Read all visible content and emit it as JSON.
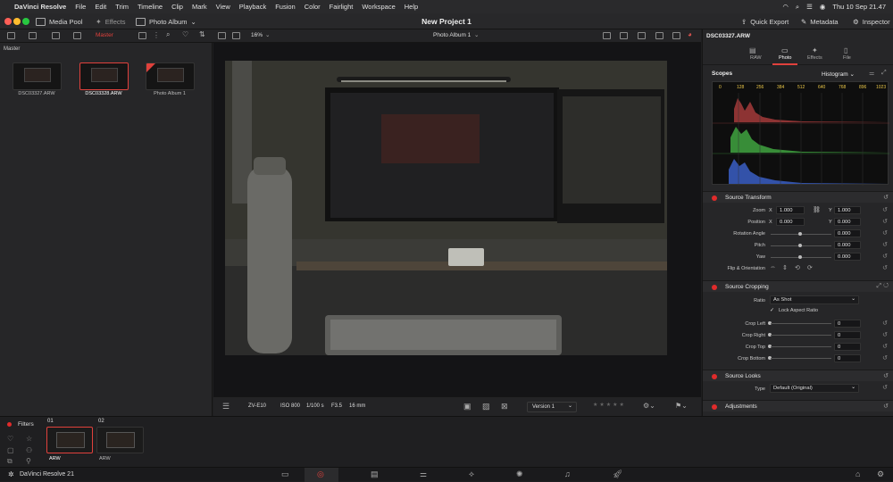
{
  "menubar": {
    "app": "DaVinci Resolve",
    "items": [
      "File",
      "Edit",
      "Trim",
      "Timeline",
      "Clip",
      "Mark",
      "View",
      "Playback",
      "Fusion",
      "Color",
      "Fairlight",
      "Workspace",
      "Help"
    ],
    "clock": "Thu 10 Sep  21.47"
  },
  "titlebar": {
    "media_pool": "Media Pool",
    "effects": "Effects",
    "album": "Photo Album",
    "project": "New Project 1",
    "quick_export": "Quick Export",
    "metadata": "Metadata",
    "inspector": "Inspector"
  },
  "toolbar": {
    "master_tag": "Master",
    "zoom": "16%",
    "album_dropdown": "Photo Album 1",
    "clip_name": "DSC03327.ARW"
  },
  "media_pool": {
    "folder": "Master",
    "clips": [
      {
        "name": "DSC03327.ARW"
      },
      {
        "name": "DSC03328.ARW"
      },
      {
        "name": "Photo Album 1"
      }
    ]
  },
  "viewer_bar": {
    "camera": "ZV-E10",
    "iso": "ISO 800",
    "shutter": "1/100 s",
    "aperture": "F3.5",
    "focal": "16 mm",
    "version": "Version 1"
  },
  "inspector": {
    "tabs": [
      "RAW",
      "Photo",
      "Effects",
      "File"
    ],
    "active_tab": "Photo",
    "scopes_label": "Scopes",
    "scope_mode": "Histogram",
    "histogram_ticks": [
      "0",
      "128",
      "256",
      "384",
      "512",
      "640",
      "768",
      "896",
      "1023"
    ],
    "source_transform": {
      "title": "Source Transform",
      "zoom_label": "Zoom",
      "zoom_x": "1.000",
      "zoom_y": "1.000",
      "position_label": "Position",
      "position_x": "0.000",
      "position_y": "0.000",
      "rotation_label": "Rotation Angle",
      "rotation": "0.000",
      "pitch_label": "Pitch",
      "pitch": "0.000",
      "yaw_label": "Yaw",
      "yaw": "0.000",
      "flip_label": "Flip & Orientation",
      "x": "X",
      "y": "Y"
    },
    "source_cropping": {
      "title": "Source Cropping",
      "ratio_label": "Ratio",
      "ratio": "As Shot",
      "lock_label": "Lock Aspect Ratio",
      "crop_left_label": "Crop Left",
      "crop_left": "0",
      "crop_right_label": "Crop Right",
      "crop_right": "0",
      "crop_top_label": "Crop Top",
      "crop_top": "0",
      "crop_bottom_label": "Crop Bottom",
      "crop_bottom": "0"
    },
    "source_looks": {
      "title": "Source Looks",
      "type_label": "Type",
      "type": "Default (Original)"
    },
    "adjustments": {
      "title": "Adjustments"
    }
  },
  "filmstrip": {
    "filters_label": "Filters",
    "clips": [
      {
        "index": "01",
        "label": "ARW"
      },
      {
        "index": "02",
        "label": "ARW"
      }
    ]
  },
  "footer": {
    "app_version": "DaVinci Resolve 21"
  },
  "colors": {
    "accent": "#e02b2b",
    "panel": "#262628",
    "viewer": "#141416"
  }
}
